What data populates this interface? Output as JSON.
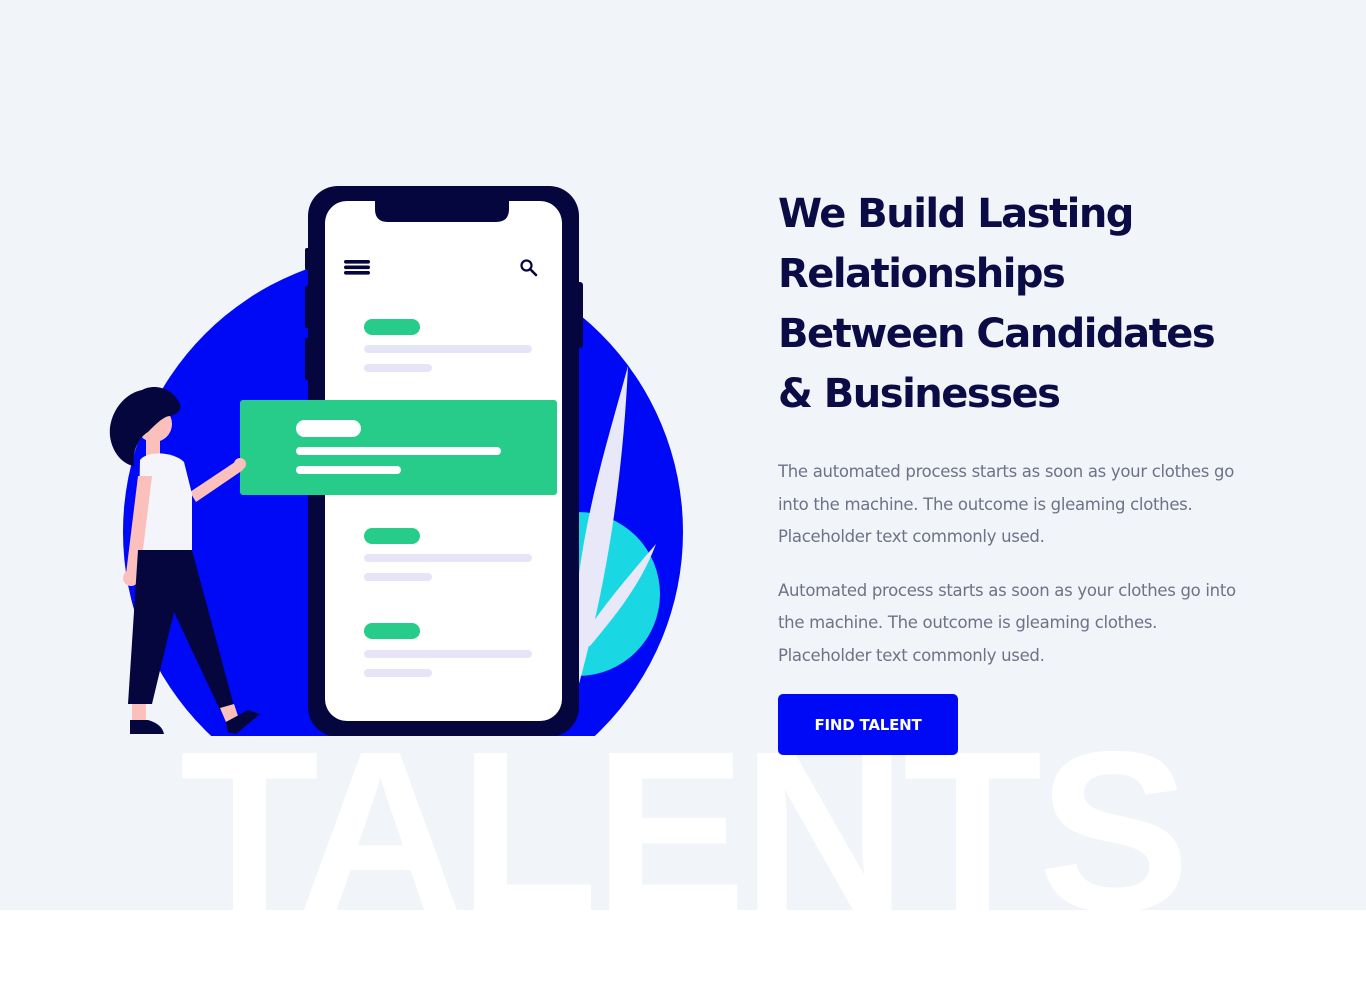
{
  "hero": {
    "headline": "We Build Lasting Relationships Between Candidates & Businesses",
    "paragraphs": [
      "The automated process starts as soon as your clothes go into the machine. The outcome is gleaming clothes. Placeholder text commonly used.",
      "Automated process starts as soon as your clothes go into the machine. The outcome is gleaming clothes. Placeholder text commonly used."
    ],
    "cta_label": "FIND TALENT",
    "watermark": "TALENTS"
  },
  "colors": {
    "background": "#f1f4f9",
    "headline": "#0b0b45",
    "body_text": "#6f7286",
    "accent_blue": "#0009f5",
    "accent_green": "#27cc8a",
    "accent_cyan": "#19d8e3"
  },
  "icons": {
    "menu": "hamburger-menu-icon",
    "search": "search-icon"
  }
}
